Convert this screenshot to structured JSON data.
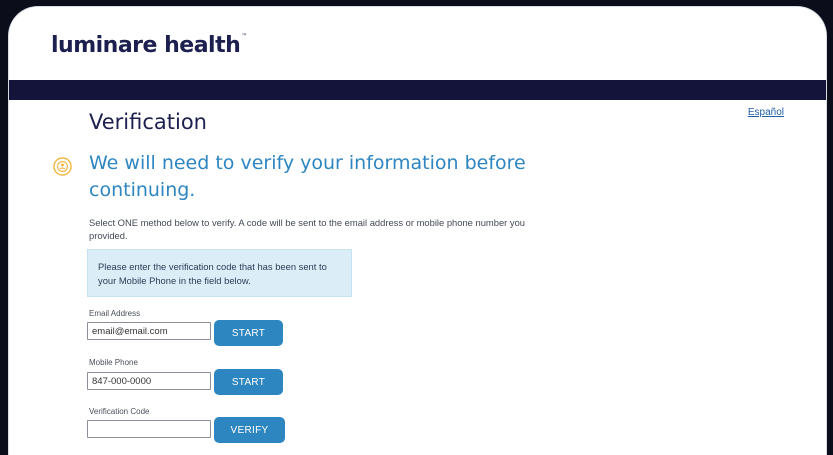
{
  "header": {
    "logo_text": "luminare health",
    "logo_tm": "™"
  },
  "language_link": "Español",
  "page": {
    "title": "Verification",
    "subheading": "We will need to verify your information before continuing.",
    "instructions": "Select ONE method below to verify. A code will be sent to the email address or mobile phone number you provided.",
    "alert": "Please enter the verification code that has been sent to your Mobile Phone in the field below."
  },
  "form": {
    "email": {
      "label": "Email Address",
      "value": "email@email.com",
      "button": "START"
    },
    "phone": {
      "label": "Mobile Phone",
      "value": "847-000-0000",
      "button": "START"
    },
    "code": {
      "label": "Verification Code",
      "value": "",
      "button": "VERIFY"
    }
  },
  "colors": {
    "brand_navy": "#14143a",
    "accent_blue": "#2e86c1",
    "alert_bg": "#dbeef8",
    "icon_gold": "#f2b23a"
  },
  "icons": {
    "info": "info-badge-icon"
  }
}
